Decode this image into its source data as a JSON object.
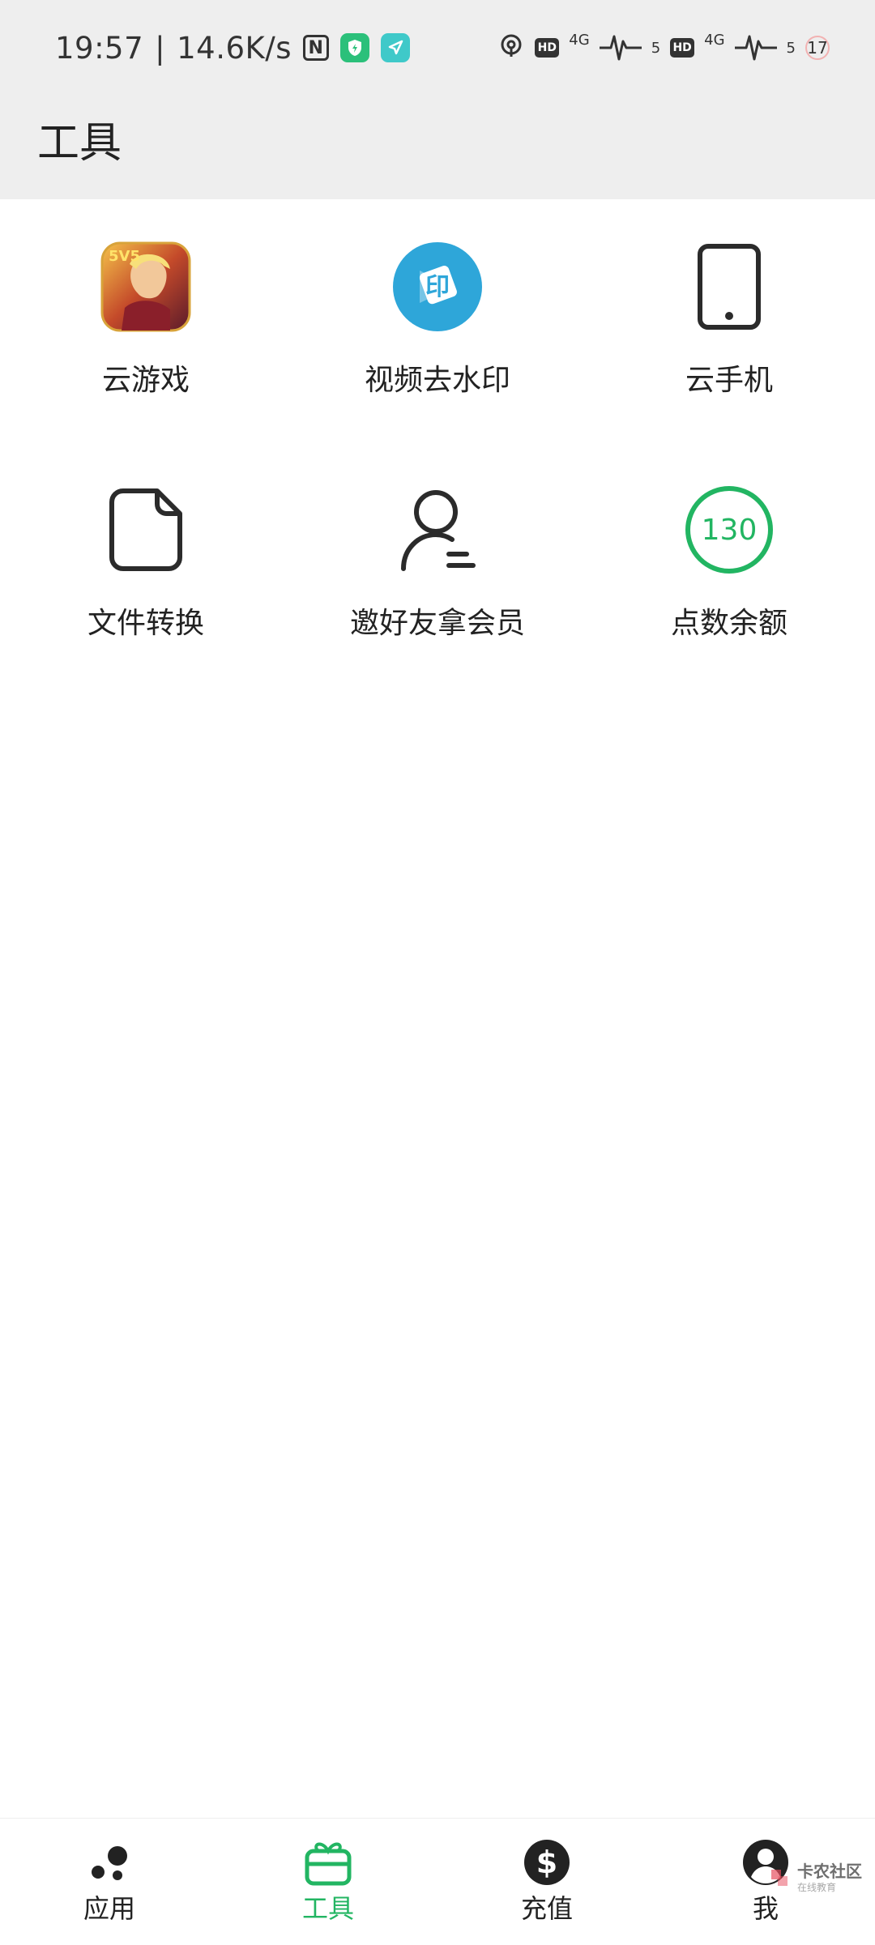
{
  "status_bar": {
    "time": "19:57",
    "speed": "14.6K/s",
    "separator": "|",
    "nfc_label": "N",
    "net1": "4G",
    "sig1": "5",
    "net2": "4G",
    "sig2": "5",
    "hd_label": "HD",
    "battery": "17",
    "icons": [
      "nfc-icon",
      "security-shield-icon",
      "location-icon",
      "hotspot-icon",
      "hd-icon",
      "signal-icon",
      "battery-icon"
    ]
  },
  "header": {
    "title": "工具"
  },
  "tools": [
    {
      "label": "云游戏",
      "icon": "game-icon"
    },
    {
      "label": "视频去水印",
      "icon": "watermark-remove-icon",
      "icon_text": "印"
    },
    {
      "label": "云手机",
      "icon": "phone-icon"
    },
    {
      "label": "文件转换",
      "icon": "file-icon"
    },
    {
      "label": "邀好友拿会员",
      "icon": "invite-friend-icon"
    },
    {
      "label": "点数余额",
      "icon": "points-balance-icon",
      "value": "130"
    }
  ],
  "bottom_nav": {
    "active_index": 1,
    "items": [
      {
        "label": "应用",
        "icon": "apps-icon"
      },
      {
        "label": "工具",
        "icon": "gift-icon"
      },
      {
        "label": "充值",
        "icon": "dollar-icon"
      },
      {
        "label": "我",
        "icon": "profile-icon"
      }
    ]
  },
  "watermark": {
    "main": "卡农社区",
    "sub": "在线教育"
  },
  "colors": {
    "accent": "#22b562",
    "header_bg": "#eeeeee",
    "video_icon": "#2ea6d9"
  }
}
